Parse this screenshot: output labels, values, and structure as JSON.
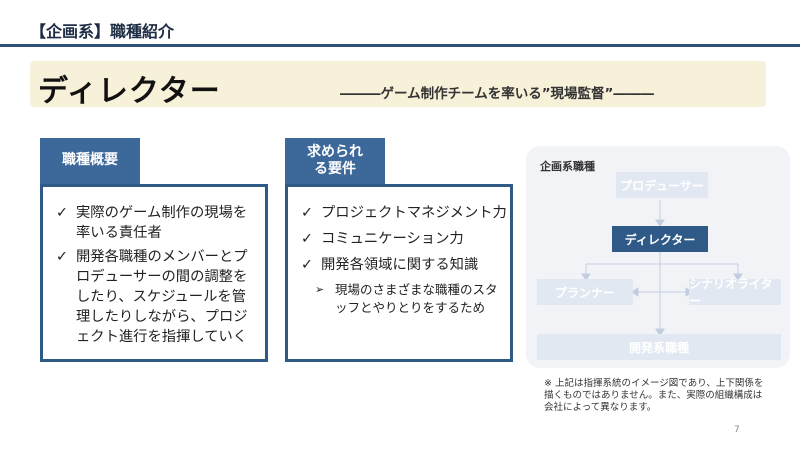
{
  "header": {
    "section_title": "【企画系】職種紹介"
  },
  "title_band": {
    "title": "ディレクター",
    "subtitle": "―――ゲーム制作チームを率いる”現場監督”―――"
  },
  "overview": {
    "label": "職種概要",
    "items": [
      "実際のゲーム制作の現場を率いる責任者",
      "開発各職種のメンバーとプロデューサーの間の調整をしたり、スケジュールを管理したりしながら、プロジェクト進行を指揮していく"
    ]
  },
  "requirements": {
    "label": "求められる要件",
    "items": [
      "プロジェクトマネジメント力",
      "コミュニケーション力",
      "開発各領域に関する知識"
    ],
    "sub_items": [
      "現場のさまざまな職種のスタッフとやりとりをするため"
    ]
  },
  "diagram": {
    "title": "企画系職種",
    "producer": "プロデューサー",
    "director": "ディレクター",
    "planner": "プランナー",
    "scenario_writer": "シナリオライター",
    "dev_jobs": "開発系職種"
  },
  "note": "※ 上記は指揮系統のイメージ図であり、上下関係を描くものではありません。また、実際の組織構成は会社によって異なります。",
  "page_number": "7"
}
